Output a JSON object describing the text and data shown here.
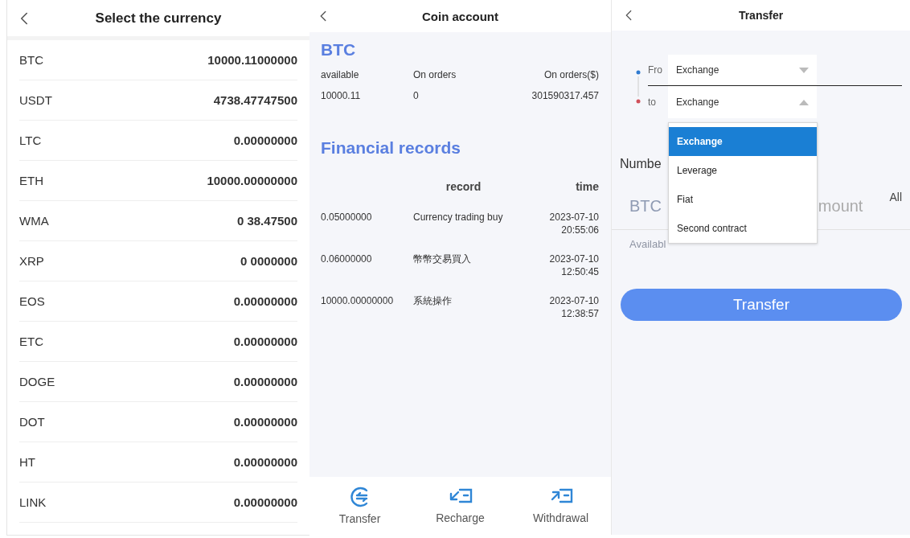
{
  "currency_screen": {
    "title": "Select the currency",
    "items": [
      {
        "symbol": "BTC",
        "balance": "10000.11000000"
      },
      {
        "symbol": "USDT",
        "balance": "4738.47747500"
      },
      {
        "symbol": "LTC",
        "balance": "0.00000000"
      },
      {
        "symbol": "ETH",
        "balance": "10000.00000000"
      },
      {
        "symbol": "WMA",
        "balance": "0 38.47500"
      },
      {
        "symbol": "XRP",
        "balance": "0 0000000"
      },
      {
        "symbol": "EOS",
        "balance": "0.00000000"
      },
      {
        "symbol": "ETC",
        "balance": "0.00000000"
      },
      {
        "symbol": "DOGE",
        "balance": "0.00000000"
      },
      {
        "symbol": "DOT",
        "balance": "0.00000000"
      },
      {
        "symbol": "HT",
        "balance": "0.00000000"
      },
      {
        "symbol": "LINK",
        "balance": "0.00000000"
      }
    ]
  },
  "coin_account": {
    "title": "Coin account",
    "coin": "BTC",
    "columns": [
      "available",
      "On orders",
      "On orders($)"
    ],
    "values": [
      "10000.11",
      "0",
      "301590317.457"
    ],
    "records_title": "Financial records",
    "record_columns": [
      "record",
      "time"
    ],
    "records": [
      {
        "amount": "0.05000000",
        "record": "Currency trading buy",
        "date": "2023-07-10",
        "time": "20:55:06"
      },
      {
        "amount": "0.06000000",
        "record": "幣幣交易買入",
        "date": "2023-07-10",
        "time": "12:50:45"
      },
      {
        "amount": "10000.00000000",
        "record": "系統操作",
        "date": "2023-07-10",
        "time": "12:38:57"
      }
    ],
    "nav": [
      {
        "kind": "transfer",
        "label": "Transfer"
      },
      {
        "kind": "recharge",
        "label": "Recharge"
      },
      {
        "kind": "withdrawal",
        "label": "Withdrawal"
      }
    ]
  },
  "transfer": {
    "title": "Transfer",
    "from": {
      "label": "Fro",
      "value": "Exchange",
      "expanded": false
    },
    "to": {
      "label": "to",
      "value": "Exchange",
      "expanded": true
    },
    "dropdown": [
      {
        "label": "Exchange",
        "selected": true
      },
      {
        "label": "Leverage",
        "selected": false
      },
      {
        "label": "Fiat",
        "selected": false
      },
      {
        "label": "Second contract",
        "selected": false
      }
    ],
    "number_label": "Numbe",
    "coin": "BTC",
    "amount_placeholder": "mount",
    "all": "All",
    "available": "Availabl",
    "button": "Transfer"
  }
}
